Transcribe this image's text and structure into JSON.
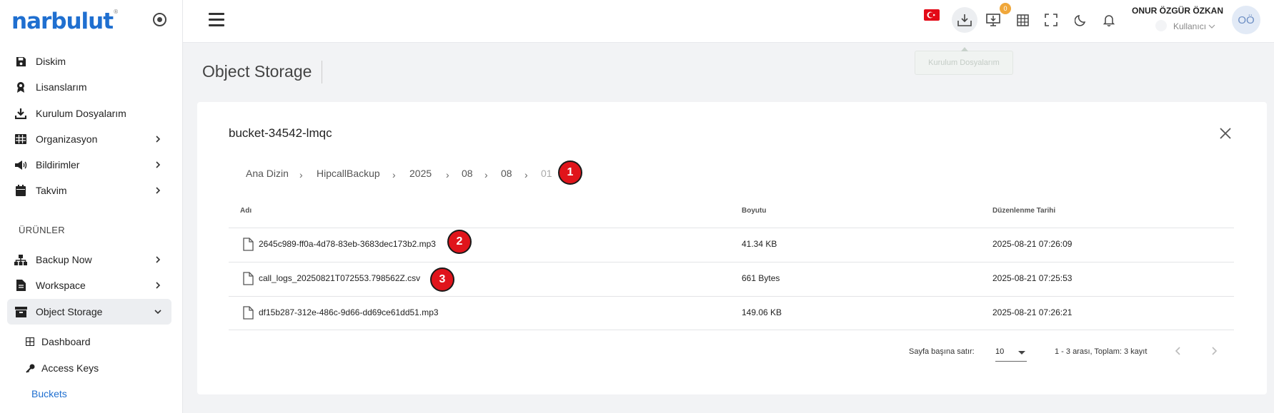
{
  "brand": {
    "name": "narbulut",
    "trademark": "®"
  },
  "sidebar": {
    "items": [
      {
        "label": "Diskim",
        "icon": "save-icon"
      },
      {
        "label": "Lisanslarım",
        "icon": "award-icon"
      },
      {
        "label": "Kurulum Dosyalarım",
        "icon": "download-icon"
      },
      {
        "label": "Organizasyon",
        "icon": "table-icon"
      },
      {
        "label": "Bildirimler",
        "icon": "megaphone-icon"
      },
      {
        "label": "Takvim",
        "icon": "calendar-icon"
      }
    ],
    "section_title": "ÜRÜNLER",
    "products": [
      {
        "label": "Backup Now",
        "icon": "sitemap-icon"
      },
      {
        "label": "Workspace",
        "icon": "document-icon"
      },
      {
        "label": "Object Storage",
        "icon": "archive-icon"
      }
    ],
    "sub_items": [
      {
        "label": "Dashboard",
        "icon": "grid-icon"
      },
      {
        "label": "Access Keys",
        "icon": "key-icon"
      },
      {
        "label": "Buckets"
      }
    ]
  },
  "header": {
    "badge_count": "0",
    "user_name": "ONUR ÖZGÜR ÖZKAN",
    "user_role": "Kullanıcı",
    "avatar_initials": "OÖ",
    "tooltip": "Kurulum Dosyalarım"
  },
  "page": {
    "title": "Object Storage"
  },
  "bucket": {
    "name": "bucket-34542-lmqc",
    "breadcrumb": [
      "Ana Dizin",
      "HipcallBackup",
      "2025",
      "08",
      "08",
      "01"
    ],
    "markers": [
      "1",
      "2",
      "3"
    ],
    "columns": {
      "name": "Adı",
      "size": "Boyutu",
      "modified": "Düzenlenme Tarihi"
    },
    "files": [
      {
        "name": "2645c989-ff0a-4d78-83eb-3683dec173b2.mp3",
        "size": "41.34 KB",
        "modified": "2025-08-21 07:26:09"
      },
      {
        "name": "call_logs_20250821T072553.798562Z.csv",
        "size": "661 Bytes",
        "modified": "2025-08-21 07:25:53"
      },
      {
        "name": "df15b287-312e-486c-9d66-dd69ce61dd51.mp3",
        "size": "149.06 KB",
        "modified": "2025-08-21 07:26:21"
      }
    ],
    "pagination": {
      "rows_label": "Sayfa başına satır:",
      "rows_value": "10",
      "range": "1 - 3 arası, Toplam: 3 kayıt"
    }
  },
  "colors": {
    "accent": "#1f6fd0",
    "marker": "#e0141b",
    "badge": "#f0a73a",
    "flag": "#e30a17"
  }
}
